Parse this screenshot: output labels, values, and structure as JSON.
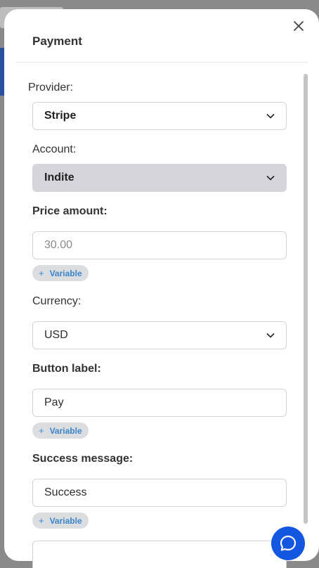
{
  "modal": {
    "title": "Payment"
  },
  "form": {
    "provider": {
      "label": "Provider:",
      "value": "Stripe"
    },
    "account": {
      "label": "Account:",
      "value": "Indite"
    },
    "price_amount": {
      "label": "Price amount:",
      "placeholder": "30.00"
    },
    "currency": {
      "label": "Currency:",
      "value": "USD"
    },
    "button_label": {
      "label": "Button label:",
      "value": "Pay"
    },
    "success_message": {
      "label": "Success message:",
      "value": "Success"
    },
    "variable_chip": "Variable"
  },
  "icons": {
    "close": "close-icon",
    "chevron": "chevron-down-icon",
    "chat": "chat-icon"
  },
  "colors": {
    "accent": "#1356e0",
    "chip_text": "#3a84c8",
    "disabled_field": "#d6d5db"
  }
}
